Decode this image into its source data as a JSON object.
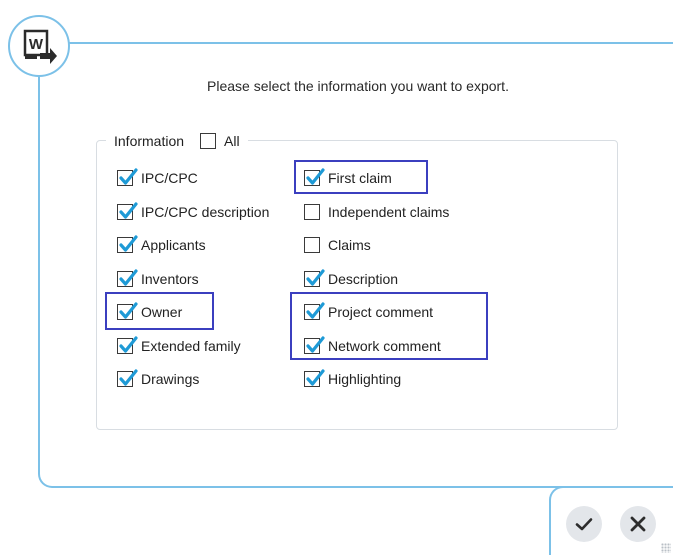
{
  "prompt": "Please select the information you want to export.",
  "group": {
    "label": "Information",
    "all_label": "All",
    "all_checked": false
  },
  "left_options": [
    {
      "label": "IPC/CPC",
      "checked": true
    },
    {
      "label": "IPC/CPC description",
      "checked": true
    },
    {
      "label": "Applicants",
      "checked": true
    },
    {
      "label": "Inventors",
      "checked": true
    },
    {
      "label": "Owner",
      "checked": true
    },
    {
      "label": "Extended family",
      "checked": true
    },
    {
      "label": "Drawings",
      "checked": true
    }
  ],
  "right_options": [
    {
      "label": "First claim",
      "checked": true
    },
    {
      "label": "Independent claims",
      "checked": false
    },
    {
      "label": "Claims",
      "checked": false
    },
    {
      "label": "Description",
      "checked": true
    },
    {
      "label": "Project comment",
      "checked": true
    },
    {
      "label": "Network comment",
      "checked": true
    },
    {
      "label": "Highlighting",
      "checked": true
    }
  ],
  "actions": {
    "confirm_icon": "check-icon",
    "cancel_icon": "close-icon"
  },
  "colors": {
    "frame": "#7cc1e8",
    "checkmark": "#1e9ad6",
    "highlight": "#3b3fbf",
    "button_bg": "#e3e6ea"
  }
}
